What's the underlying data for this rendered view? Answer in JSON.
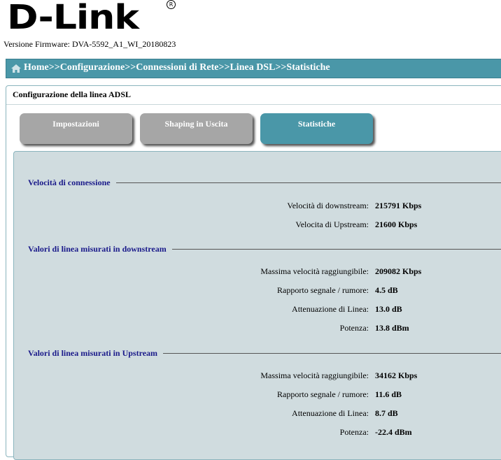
{
  "brand": {
    "logo_text": "D-Link",
    "reg_mark": "R"
  },
  "firmware": "Versione Firmware: DVA-5592_A1_WI_20180823",
  "breadcrumb": {
    "home": "Home",
    "sep": ">>",
    "items": [
      "Configurazione",
      "Connessioni di Rete",
      "Linea DSL",
      "Statistiche"
    ]
  },
  "panel": {
    "title": "Configurazione della linea ADSL"
  },
  "tabs": [
    {
      "label": "Impostazioni",
      "active": false
    },
    {
      "label": "Shaping in Uscita",
      "active": false
    },
    {
      "label": "Statistiche",
      "active": true
    }
  ],
  "sections": [
    {
      "title": "Velocità di connessione",
      "rows": [
        {
          "label": "Velocità di downstream:",
          "value": "215791 Kbps"
        },
        {
          "label": "Velocita di Upstream:",
          "value": "21600 Kbps"
        }
      ]
    },
    {
      "title": "Valori di linea misurati in downstream",
      "rows": [
        {
          "label": "Massima velocità raggiungibile:",
          "value": "209082 Kbps"
        },
        {
          "label": "Rapporto segnale / rumore:",
          "value": "4.5 dB"
        },
        {
          "label": "Attenuazione di Linea:",
          "value": "13.0 dB"
        },
        {
          "label": "Potenza:",
          "value": "13.8 dBm"
        }
      ]
    },
    {
      "title": "Valori di linea misurati in Upstream",
      "rows": [
        {
          "label": "Massima velocità raggiungibile:",
          "value": "34162 Kbps"
        },
        {
          "label": "Rapporto segnale / rumore:",
          "value": "11.6 dB"
        },
        {
          "label": "Attenuazione di Linea:",
          "value": "8.7 dB"
        },
        {
          "label": "Potenza:",
          "value": "-22.4 dBm"
        }
      ]
    }
  ],
  "colors": {
    "accent": "#4a97a8",
    "tab_inactive": "#a6a6a6",
    "content_bg": "#d0dcdf",
    "section_title": "#1a1a8a"
  },
  "icons": {
    "home": "home-icon"
  }
}
